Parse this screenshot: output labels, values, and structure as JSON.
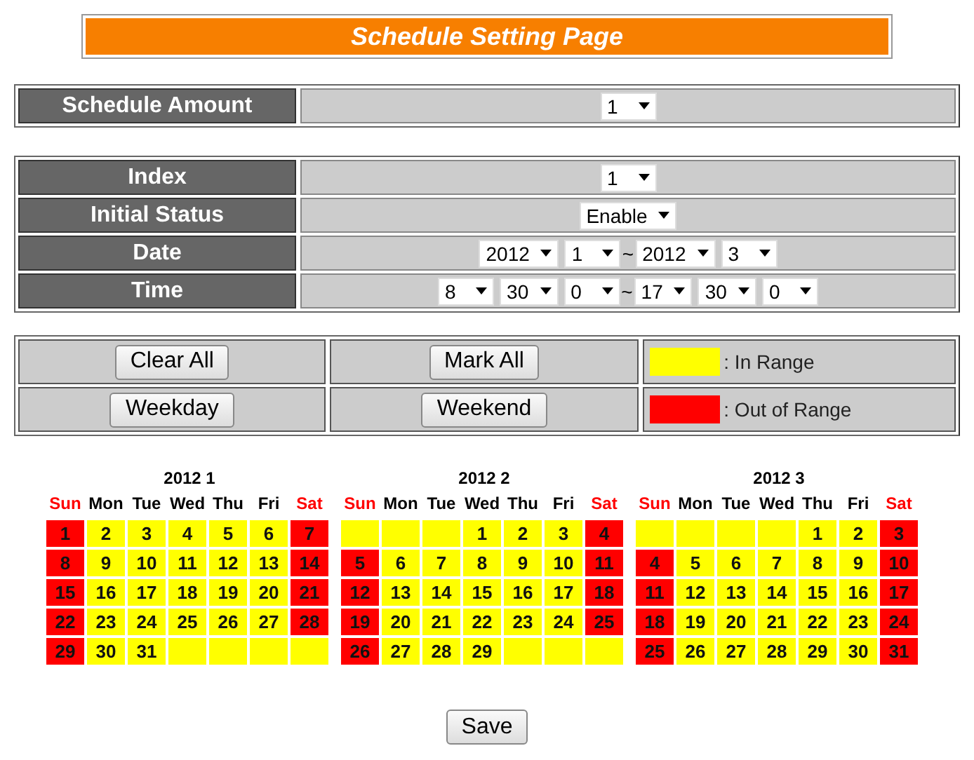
{
  "title": "Schedule Setting Page",
  "amount": {
    "label": "Schedule Amount",
    "fields": [
      {
        "kind": "select",
        "value": "1"
      }
    ]
  },
  "settings": [
    {
      "label": "Index",
      "fields": [
        {
          "kind": "select",
          "value": "1"
        }
      ]
    },
    {
      "label": "Initial Status",
      "fields": [
        {
          "kind": "select",
          "value": "Enable"
        }
      ]
    },
    {
      "label": "Date",
      "fields": [
        {
          "kind": "select",
          "value": "2012"
        },
        {
          "kind": "select",
          "value": "1"
        },
        {
          "kind": "text",
          "value": "~"
        },
        {
          "kind": "select",
          "value": "2012"
        },
        {
          "kind": "select",
          "value": "3"
        }
      ]
    },
    {
      "label": "Time",
      "fields": [
        {
          "kind": "select",
          "value": "8"
        },
        {
          "kind": "select",
          "value": "30"
        },
        {
          "kind": "select",
          "value": "0"
        },
        {
          "kind": "text",
          "value": "~"
        },
        {
          "kind": "select",
          "value": "17"
        },
        {
          "kind": "select",
          "value": "30"
        },
        {
          "kind": "select",
          "value": "0"
        }
      ]
    }
  ],
  "actions": [
    {
      "buttons": [
        "Clear All",
        "Mark All"
      ],
      "legend": {
        "color": "#ffff00",
        "label": ": In Range"
      }
    },
    {
      "buttons": [
        "Weekday",
        "Weekend"
      ],
      "legend": {
        "color": "#ff0000",
        "label": ": Out of Range"
      }
    }
  ],
  "months": [
    {
      "title": "2012 1",
      "weekdays": [
        {
          "label": "Sun",
          "kind": "weekend"
        },
        {
          "label": "Mon",
          "kind": "weekday"
        },
        {
          "label": "Tue",
          "kind": "weekday"
        },
        {
          "label": "Wed",
          "kind": "weekday"
        },
        {
          "label": "Thu",
          "kind": "weekday"
        },
        {
          "label": "Fri",
          "kind": "weekday"
        },
        {
          "label": "Sat",
          "kind": "weekend"
        }
      ],
      "weeks": [
        [
          {
            "day": "1",
            "in_range": false
          },
          {
            "day": "2",
            "in_range": true
          },
          {
            "day": "3",
            "in_range": true
          },
          {
            "day": "4",
            "in_range": true
          },
          {
            "day": "5",
            "in_range": true
          },
          {
            "day": "6",
            "in_range": true
          },
          {
            "day": "7",
            "in_range": false
          }
        ],
        [
          {
            "day": "8",
            "in_range": false
          },
          {
            "day": "9",
            "in_range": true
          },
          {
            "day": "10",
            "in_range": true
          },
          {
            "day": "11",
            "in_range": true
          },
          {
            "day": "12",
            "in_range": true
          },
          {
            "day": "13",
            "in_range": true
          },
          {
            "day": "14",
            "in_range": false
          }
        ],
        [
          {
            "day": "15",
            "in_range": false
          },
          {
            "day": "16",
            "in_range": true
          },
          {
            "day": "17",
            "in_range": true
          },
          {
            "day": "18",
            "in_range": true
          },
          {
            "day": "19",
            "in_range": true
          },
          {
            "day": "20",
            "in_range": true
          },
          {
            "day": "21",
            "in_range": false
          }
        ],
        [
          {
            "day": "22",
            "in_range": false
          },
          {
            "day": "23",
            "in_range": true
          },
          {
            "day": "24",
            "in_range": true
          },
          {
            "day": "25",
            "in_range": true
          },
          {
            "day": "26",
            "in_range": true
          },
          {
            "day": "27",
            "in_range": true
          },
          {
            "day": "28",
            "in_range": false
          }
        ],
        [
          {
            "day": "29",
            "in_range": false
          },
          {
            "day": "30",
            "in_range": true
          },
          {
            "day": "31",
            "in_range": true
          },
          {
            "in_range": true
          },
          {
            "in_range": true
          },
          {
            "in_range": true
          },
          {
            "in_range": true
          }
        ]
      ]
    },
    {
      "title": "2012 2",
      "weekdays": [
        {
          "label": "Sun",
          "kind": "weekend"
        },
        {
          "label": "Mon",
          "kind": "weekday"
        },
        {
          "label": "Tue",
          "kind": "weekday"
        },
        {
          "label": "Wed",
          "kind": "weekday"
        },
        {
          "label": "Thu",
          "kind": "weekday"
        },
        {
          "label": "Fri",
          "kind": "weekday"
        },
        {
          "label": "Sat",
          "kind": "weekend"
        }
      ],
      "weeks": [
        [
          {
            "in_range": true
          },
          {
            "in_range": true
          },
          {
            "in_range": true
          },
          {
            "day": "1",
            "in_range": true
          },
          {
            "day": "2",
            "in_range": true
          },
          {
            "day": "3",
            "in_range": true
          },
          {
            "day": "4",
            "in_range": false
          }
        ],
        [
          {
            "day": "5",
            "in_range": false
          },
          {
            "day": "6",
            "in_range": true
          },
          {
            "day": "7",
            "in_range": true
          },
          {
            "day": "8",
            "in_range": true
          },
          {
            "day": "9",
            "in_range": true
          },
          {
            "day": "10",
            "in_range": true
          },
          {
            "day": "11",
            "in_range": false
          }
        ],
        [
          {
            "day": "12",
            "in_range": false
          },
          {
            "day": "13",
            "in_range": true
          },
          {
            "day": "14",
            "in_range": true
          },
          {
            "day": "15",
            "in_range": true
          },
          {
            "day": "16",
            "in_range": true
          },
          {
            "day": "17",
            "in_range": true
          },
          {
            "day": "18",
            "in_range": false
          }
        ],
        [
          {
            "day": "19",
            "in_range": false
          },
          {
            "day": "20",
            "in_range": true
          },
          {
            "day": "21",
            "in_range": true
          },
          {
            "day": "22",
            "in_range": true
          },
          {
            "day": "23",
            "in_range": true
          },
          {
            "day": "24",
            "in_range": true
          },
          {
            "day": "25",
            "in_range": false
          }
        ],
        [
          {
            "day": "26",
            "in_range": false
          },
          {
            "day": "27",
            "in_range": true
          },
          {
            "day": "28",
            "in_range": true
          },
          {
            "day": "29",
            "in_range": true
          },
          {
            "in_range": true
          },
          {
            "in_range": true
          },
          {
            "in_range": true
          }
        ]
      ]
    },
    {
      "title": "2012 3",
      "weekdays": [
        {
          "label": "Sun",
          "kind": "weekend"
        },
        {
          "label": "Mon",
          "kind": "weekday"
        },
        {
          "label": "Tue",
          "kind": "weekday"
        },
        {
          "label": "Wed",
          "kind": "weekday"
        },
        {
          "label": "Thu",
          "kind": "weekday"
        },
        {
          "label": "Fri",
          "kind": "weekday"
        },
        {
          "label": "Sat",
          "kind": "weekend"
        }
      ],
      "weeks": [
        [
          {
            "in_range": true
          },
          {
            "in_range": true
          },
          {
            "in_range": true
          },
          {
            "in_range": true
          },
          {
            "day": "1",
            "in_range": true
          },
          {
            "day": "2",
            "in_range": true
          },
          {
            "day": "3",
            "in_range": false
          }
        ],
        [
          {
            "day": "4",
            "in_range": false
          },
          {
            "day": "5",
            "in_range": true
          },
          {
            "day": "6",
            "in_range": true
          },
          {
            "day": "7",
            "in_range": true
          },
          {
            "day": "8",
            "in_range": true
          },
          {
            "day": "9",
            "in_range": true
          },
          {
            "day": "10",
            "in_range": false
          }
        ],
        [
          {
            "day": "11",
            "in_range": false
          },
          {
            "day": "12",
            "in_range": true
          },
          {
            "day": "13",
            "in_range": true
          },
          {
            "day": "14",
            "in_range": true
          },
          {
            "day": "15",
            "in_range": true
          },
          {
            "day": "16",
            "in_range": true
          },
          {
            "day": "17",
            "in_range": false
          }
        ],
        [
          {
            "day": "18",
            "in_range": false
          },
          {
            "day": "19",
            "in_range": true
          },
          {
            "day": "20",
            "in_range": true
          },
          {
            "day": "21",
            "in_range": true
          },
          {
            "day": "22",
            "in_range": true
          },
          {
            "day": "23",
            "in_range": true
          },
          {
            "day": "24",
            "in_range": false
          }
        ],
        [
          {
            "day": "25",
            "in_range": false
          },
          {
            "day": "26",
            "in_range": true
          },
          {
            "day": "27",
            "in_range": true
          },
          {
            "day": "28",
            "in_range": true
          },
          {
            "day": "29",
            "in_range": true
          },
          {
            "day": "30",
            "in_range": true
          },
          {
            "day": "31",
            "in_range": false
          }
        ]
      ]
    }
  ],
  "save": "Save"
}
